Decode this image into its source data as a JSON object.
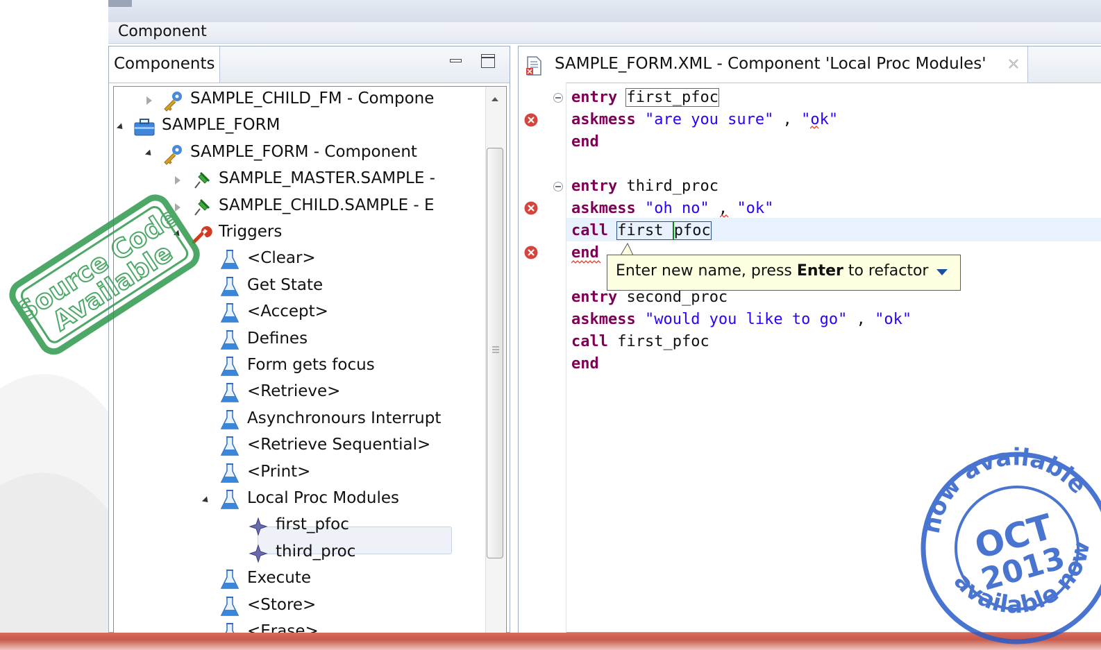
{
  "window": {
    "title": "Component"
  },
  "components_view": {
    "tab_label": "Components",
    "tree": [
      {
        "label": "SAMPLE_CHILD_FM - Compone",
        "icon": "component-key-icon",
        "expanded": false
      },
      {
        "label": "SAMPLE_FORM",
        "icon": "form-toolbox-icon",
        "expanded": true
      },
      {
        "label": "SAMPLE_FORM - Component",
        "icon": "component-key-icon",
        "expanded": true
      },
      {
        "label": "SAMPLE_MASTER.SAMPLE -",
        "icon": "entity-pin-icon",
        "expanded": false
      },
      {
        "label": "SAMPLE_CHILD.SAMPLE - E",
        "icon": "entity-pin-icon",
        "expanded": false
      },
      {
        "label": "Triggers",
        "icon": "wrench-icon",
        "expanded": true
      },
      {
        "label": "<Clear>",
        "icon": "flask-icon"
      },
      {
        "label": "Get State",
        "icon": "flask-icon"
      },
      {
        "label": "<Accept>",
        "icon": "flask-icon"
      },
      {
        "label": "Defines",
        "icon": "flask-icon"
      },
      {
        "label": "Form gets focus",
        "icon": "flask-icon"
      },
      {
        "label": "<Retrieve>",
        "icon": "flask-icon"
      },
      {
        "label": "Asynchronours Interrupt",
        "icon": "flask-icon"
      },
      {
        "label": "<Retrieve Sequential>",
        "icon": "flask-icon"
      },
      {
        "label": "<Print>",
        "icon": "flask-icon"
      },
      {
        "label": "Local Proc Modules",
        "icon": "flask-icon",
        "expanded": true,
        "selected": true
      },
      {
        "label": "first_pfoc",
        "icon": "proc-diamond-icon"
      },
      {
        "label": "third_proc",
        "icon": "proc-diamond-icon"
      },
      {
        "label": "Execute",
        "icon": "flask-icon"
      },
      {
        "label": "<Store>",
        "icon": "flask-icon"
      },
      {
        "label": "<Erase>",
        "icon": "flask-icon"
      }
    ]
  },
  "editor": {
    "tab_title": "SAMPLE_FORM.XML - Component 'Local Proc Modules'",
    "lines": [
      {
        "kw": "entry",
        "rest": "first_pfoc"
      },
      {
        "kw": "askmess",
        "s1": "\"are you sure\"",
        "sep": " , ",
        "s2": "\"ok\""
      },
      {
        "kw": "end"
      },
      {
        "kw": "entry",
        "rest": "third_proc"
      },
      {
        "kw": "askmess",
        "s1": "\"oh no\"",
        "sep": " , ",
        "s2": "\"ok\""
      },
      {
        "kw": "call",
        "a": "first",
        "b": "pfoc"
      },
      {
        "kw": "end"
      },
      {
        "kw": "entry",
        "rest": "second_proc"
      },
      {
        "kw": "askmess",
        "s1": "\"would you like to go\"",
        "sep": " , ",
        "s2": "\"ok\""
      },
      {
        "kw": "call",
        "rest": "first_pfoc"
      },
      {
        "kw": "end"
      }
    ],
    "tooltip": {
      "pre": "Enter new name, press ",
      "bold": "Enter",
      "post": " to refactor"
    }
  },
  "stamps": {
    "left_line1": "Source Code",
    "left_line2": "Available",
    "right_top": "now available",
    "right_month": "OCT",
    "right_year": "2013",
    "right_bottom": "available now"
  },
  "colors": {
    "keyword": "#7f0055",
    "string": "#2a00ff",
    "tooltip_bg": "#ffffe1",
    "error": "#d6453d",
    "stamp_green": "#2e9a4e",
    "stamp_blue": "#2a5cc8",
    "bottom_bar": "#c6594b"
  }
}
